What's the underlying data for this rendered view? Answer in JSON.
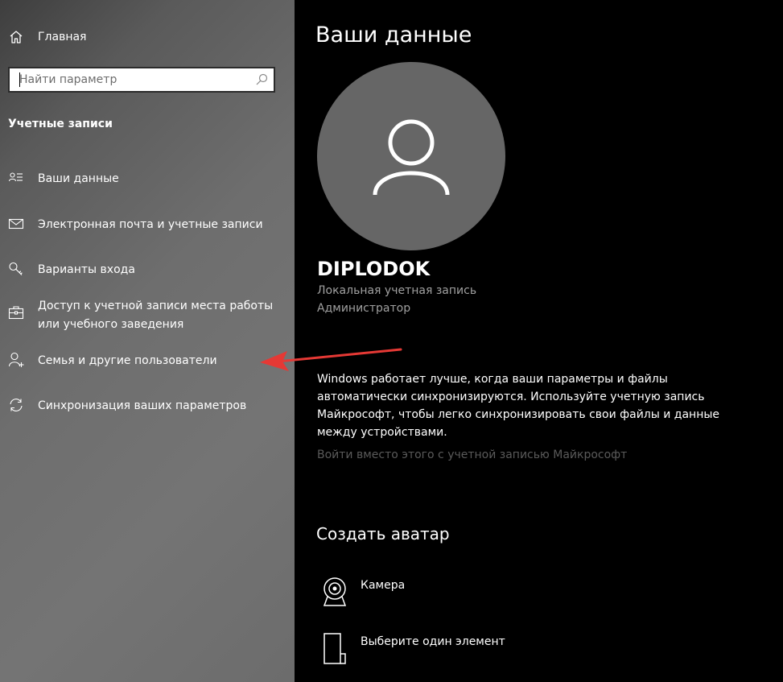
{
  "sidebar": {
    "home_label": "Главная",
    "search": {
      "placeholder": "Найти параметр",
      "value": ""
    },
    "section_title": "Учетные записи",
    "items": [
      {
        "label": "Ваши данные",
        "icon": "user-info-icon"
      },
      {
        "label": "Электронная почта и учетные записи",
        "icon": "mail-icon"
      },
      {
        "label": "Варианты входа",
        "icon": "key-icon"
      },
      {
        "label": "Доступ к учетной записи места работы или учебного заведения",
        "icon": "briefcase-icon"
      },
      {
        "label": "Семья и другие пользователи",
        "icon": "add-user-icon"
      },
      {
        "label": "Синхронизация ваших параметров",
        "icon": "sync-icon"
      }
    ]
  },
  "content": {
    "title": "Ваши данные",
    "user": {
      "name": "DIPLODOK",
      "account_type": "Локальная учетная запись",
      "role": "Администратор"
    },
    "description": "Windows работает лучше, когда ваши параметры и файлы автоматически синхронизируются. Используйте учетную запись Майкрософт, чтобы легко синхронизировать свои файлы и данные между устройствами.",
    "ms_link": "Войти вместо этого с учетной записью Майкрософт",
    "create_avatar": {
      "title": "Создать аватар",
      "options": [
        {
          "label": "Камера",
          "icon": "camera-icon"
        },
        {
          "label": "Выберите один элемент",
          "icon": "file-icon"
        }
      ]
    }
  },
  "colors": {
    "content_bg": "#000000",
    "avatar_bg": "#666666",
    "arrow": "#e53935",
    "link_disabled": "#5a5a5a"
  }
}
